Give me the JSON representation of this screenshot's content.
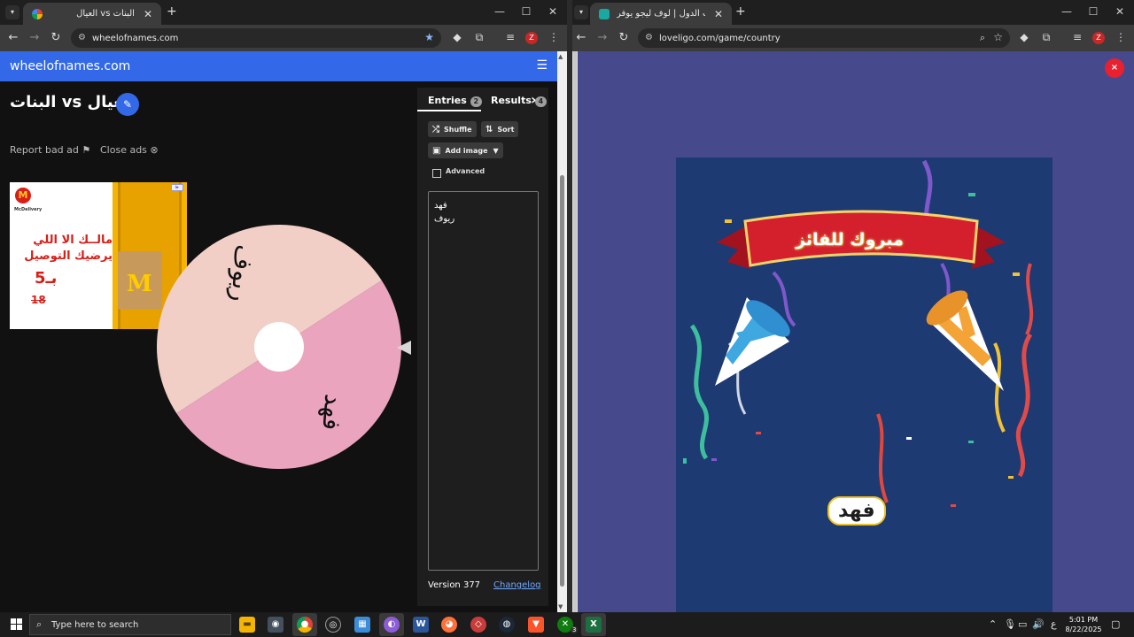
{
  "left_window": {
    "tab_title": "العيال vs البنات",
    "url": "wheelofnames.com",
    "header": {
      "brand": "wheelofnames.com"
    },
    "wheel_title": "البنات vs العيال",
    "ad_actions": {
      "report": "Report bad ad",
      "close": "Close ads"
    },
    "ad": {
      "brand": "McDelivery",
      "line1": "مالــك الا اللي",
      "line2": "يرضيك التوصيل",
      "price": "بـ5",
      "old_price": "18"
    },
    "wheel": {
      "segments": [
        {
          "label": "ريوف",
          "color": "#eba4be"
        },
        {
          "label": "فهد",
          "color": "#f2cfc6"
        }
      ],
      "hub_color": "#ffffff"
    },
    "panel": {
      "tabs": [
        {
          "label": "Entries",
          "count": "2"
        },
        {
          "label": "Results",
          "count": "4"
        }
      ],
      "buttons": {
        "shuffle": "Shuffle",
        "sort": "Sort",
        "add_image": "Add image"
      },
      "advanced_label": "Advanced",
      "entries": [
        "فهد",
        "ريوف"
      ],
      "version": "Version 377",
      "changelog": "Changelog"
    }
  },
  "right_window": {
    "tab_title": "لعبة حرب الدول | لوف ليجو يوفر",
    "url": "loveligo.com/game/country",
    "close_label": "×",
    "banner_text": "مبروك للفائز",
    "winner": "فهد"
  },
  "taskbar": {
    "search_placeholder": "Type here to search",
    "xbox_badge": "3",
    "lang": "ع",
    "time": "5:01 PM",
    "date": "8/22/2025"
  },
  "colors": {
    "won_blue": "#3369e8",
    "right_bg": "#464a8c",
    "confetti_bg": "#1d3a73",
    "accent_red": "#e8202f"
  }
}
